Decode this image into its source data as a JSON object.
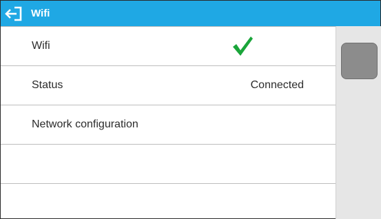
{
  "header": {
    "title": "Wifi",
    "back_icon": "back-arrow-exit-icon",
    "background_color": "#1fa8e4"
  },
  "rows": [
    {
      "label": "Wifi",
      "value": "",
      "icon": "checkmark-icon",
      "icon_color": "#1aa53a"
    },
    {
      "label": "Status",
      "value": "Connected"
    },
    {
      "label": "Network configuration",
      "value": ""
    },
    {
      "label": "",
      "value": ""
    },
    {
      "label": "",
      "value": ""
    }
  ],
  "scrollbar": {
    "position_fraction": 0.0
  }
}
